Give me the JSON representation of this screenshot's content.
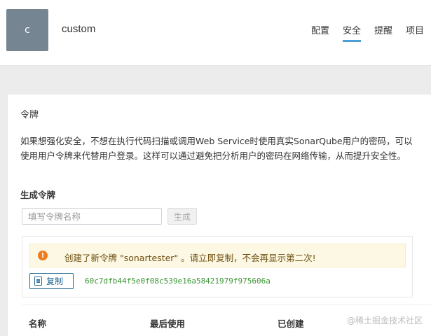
{
  "header": {
    "avatar_letter": "c",
    "username": "custom",
    "tabs": [
      {
        "label": "配置",
        "active": false
      },
      {
        "label": "安全",
        "active": true
      },
      {
        "label": "提醒",
        "active": false
      },
      {
        "label": "项目",
        "active": false
      }
    ]
  },
  "tokens": {
    "section_title": "令牌",
    "description": "如果想强化安全，不想在执行代码扫描或调用Web Service时使用真实SonarQube用户的密码，可以使用用户令牌来代替用户登录。这样可以通过避免把分析用户的密码在网络传输，从而提升安全性。",
    "generate_title": "生成令牌",
    "input_placeholder": "填写令牌名称",
    "generate_button": "生成",
    "alert_text": "创建了新令牌 \"sonartester\" 。请立即复制，不会再显示第二次!",
    "copy_button": "复制",
    "token_value": "60c7dfb44f5e0f08c539e16a58421979f975606a",
    "table_headers": [
      "名称",
      "最后使用",
      "已创建"
    ]
  },
  "watermark": "@稀土掘金技术社区",
  "colors": {
    "accent": "#4b9fd5",
    "avatar_bg": "#758591",
    "warning": "#ed7d20",
    "token_green": "#3a9632",
    "copy_blue": "#236a97"
  }
}
